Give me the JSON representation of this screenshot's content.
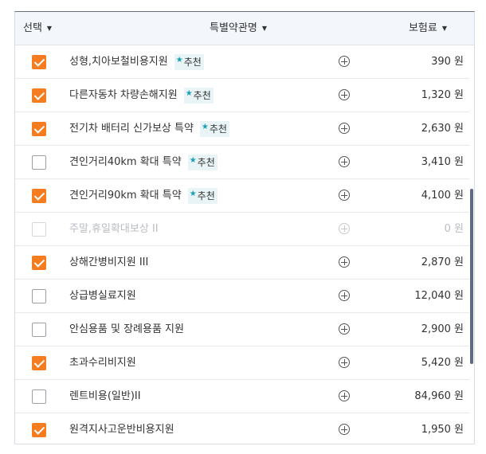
{
  "header": {
    "select_label": "선택",
    "name_label": "특별약관명",
    "premium_label": "보험료",
    "sort_icon": "triangle-down"
  },
  "badge_star": "★",
  "rows": [
    {
      "checked": true,
      "disabled": false,
      "name": "성형,치아보철비용지원",
      "badge": "추천",
      "price": "390 원"
    },
    {
      "checked": true,
      "disabled": false,
      "name": "다른자동차 차량손해지원",
      "badge": "추천",
      "price": "1,320 원"
    },
    {
      "checked": true,
      "disabled": false,
      "name": "전기차 배터리 신가보상 특약",
      "badge": "추천",
      "price": "2,630 원"
    },
    {
      "checked": false,
      "disabled": false,
      "name": "견인거리40km 확대 특약",
      "badge": "추천",
      "price": "3,410 원"
    },
    {
      "checked": true,
      "disabled": false,
      "name": "견인거리90km 확대 특약",
      "badge": "추천",
      "price": "4,100 원"
    },
    {
      "checked": false,
      "disabled": true,
      "name": "주말,휴일확대보상 II",
      "badge": "",
      "price": "0 원"
    },
    {
      "checked": true,
      "disabled": false,
      "name": "상해간병비지원 III",
      "badge": "",
      "price": "2,870 원"
    },
    {
      "checked": false,
      "disabled": false,
      "name": "상급병실료지원",
      "badge": "",
      "price": "12,040 원"
    },
    {
      "checked": false,
      "disabled": false,
      "name": "안심용품 및 장례용품 지원",
      "badge": "",
      "price": "2,900 원"
    },
    {
      "checked": true,
      "disabled": false,
      "name": "초과수리비지원",
      "badge": "",
      "price": "5,420 원"
    },
    {
      "checked": false,
      "disabled": false,
      "name": "렌트비용(일반)II",
      "badge": "",
      "price": "84,960 원"
    },
    {
      "checked": true,
      "disabled": false,
      "name": "원격지사고운반비용지원",
      "badge": "",
      "price": "1,950 원"
    }
  ],
  "colors": {
    "accent": "#f57c1f",
    "badge_bg": "#e9f4f6",
    "star": "#1aa0b5"
  }
}
